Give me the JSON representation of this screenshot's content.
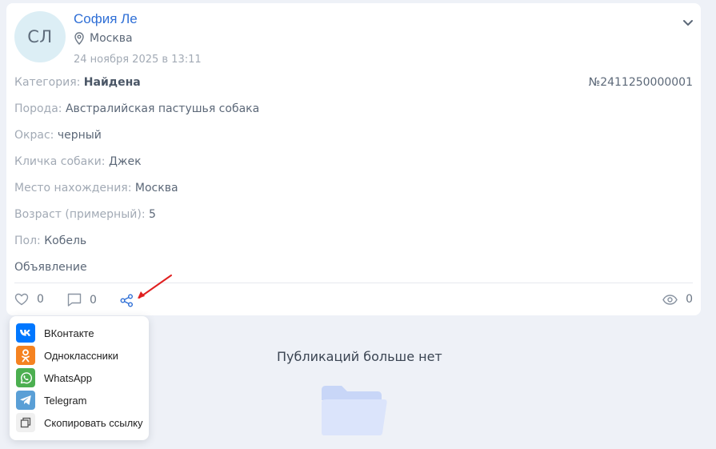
{
  "post": {
    "avatar_initials": "СЛ",
    "author_name": "София Ле",
    "city": "Москва",
    "date": "24 ноября 2025 в 13:11",
    "number": "№2411250000001",
    "fields": [
      {
        "label": "Категория: ",
        "value": "Найдена"
      },
      {
        "label": "Порода: ",
        "value": "Австралийская пастушья собака"
      },
      {
        "label": "Окрас: ",
        "value": "черный"
      },
      {
        "label": "Кличка собаки: ",
        "value": "Джек"
      },
      {
        "label": "Место нахождения: ",
        "value": "Москва"
      },
      {
        "label": "Возраст (примерный): ",
        "value": "5"
      },
      {
        "label": "Пол: ",
        "value": "Кобель"
      }
    ],
    "ad_label": "Объявление",
    "likes": "0",
    "comments": "0",
    "views": "0"
  },
  "share_menu": {
    "items": [
      {
        "label": "ВКонтакте",
        "icon": "vk-icon",
        "color": "#0077ff"
      },
      {
        "label": "Одноклассники",
        "icon": "ok-icon",
        "color": "#f58220"
      },
      {
        "label": "WhatsApp",
        "icon": "whatsapp-icon",
        "color": "#4caf50"
      },
      {
        "label": "Telegram",
        "icon": "telegram-icon",
        "color": "#5a9fd6"
      },
      {
        "label": "Скопировать ссылку",
        "icon": "copy-icon",
        "color": "#f0f0f0"
      }
    ]
  },
  "feed": {
    "empty_text": "Публикаций больше нет"
  },
  "colors": {
    "accent": "#2f6fd6",
    "arrow": "#e02020",
    "folder": "#d6e1fb"
  }
}
